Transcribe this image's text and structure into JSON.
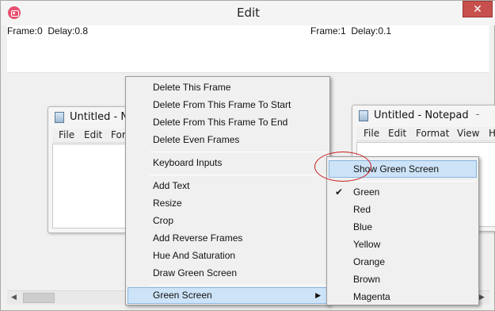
{
  "window": {
    "title": "Edit",
    "close_label": "✕"
  },
  "frames": [
    {
      "frame_label": "Frame:0",
      "delay_label": "Delay:0.8"
    },
    {
      "frame_label": "Frame:1",
      "delay_label": "Delay:0.1"
    }
  ],
  "notepad_left": {
    "title": "Untitled - No",
    "menus": [
      "File",
      "Edit",
      "For"
    ]
  },
  "notepad_right": {
    "title": "Untitled - Notepad",
    "menus": [
      "File",
      "Edit",
      "Format",
      "View",
      "H"
    ]
  },
  "context_menu": {
    "items": [
      "Delete This Frame",
      "Delete From This Frame To Start",
      "Delete From This Frame To End",
      "Delete Even Frames",
      "Keyboard Inputs",
      "Add Text",
      "Resize",
      "Crop",
      "Add Reverse Frames",
      "Hue And Saturation",
      "Draw Green Screen",
      "Green Screen"
    ],
    "submenu_arrow": "▶"
  },
  "green_screen_submenu": {
    "show_label": "Show Green Screen",
    "colors": [
      "Green",
      "Red",
      "Blue",
      "Yellow",
      "Orange",
      "Brown",
      "Magenta"
    ],
    "checked": "Green",
    "check_glyph": "✔"
  },
  "scrollbar": {
    "left_arrow": "◀",
    "right_arrow": "▶"
  },
  "colors": {
    "highlight": "#cde3f7",
    "close_button": "#c7504d",
    "annotation_circle": "#c81c1c"
  }
}
